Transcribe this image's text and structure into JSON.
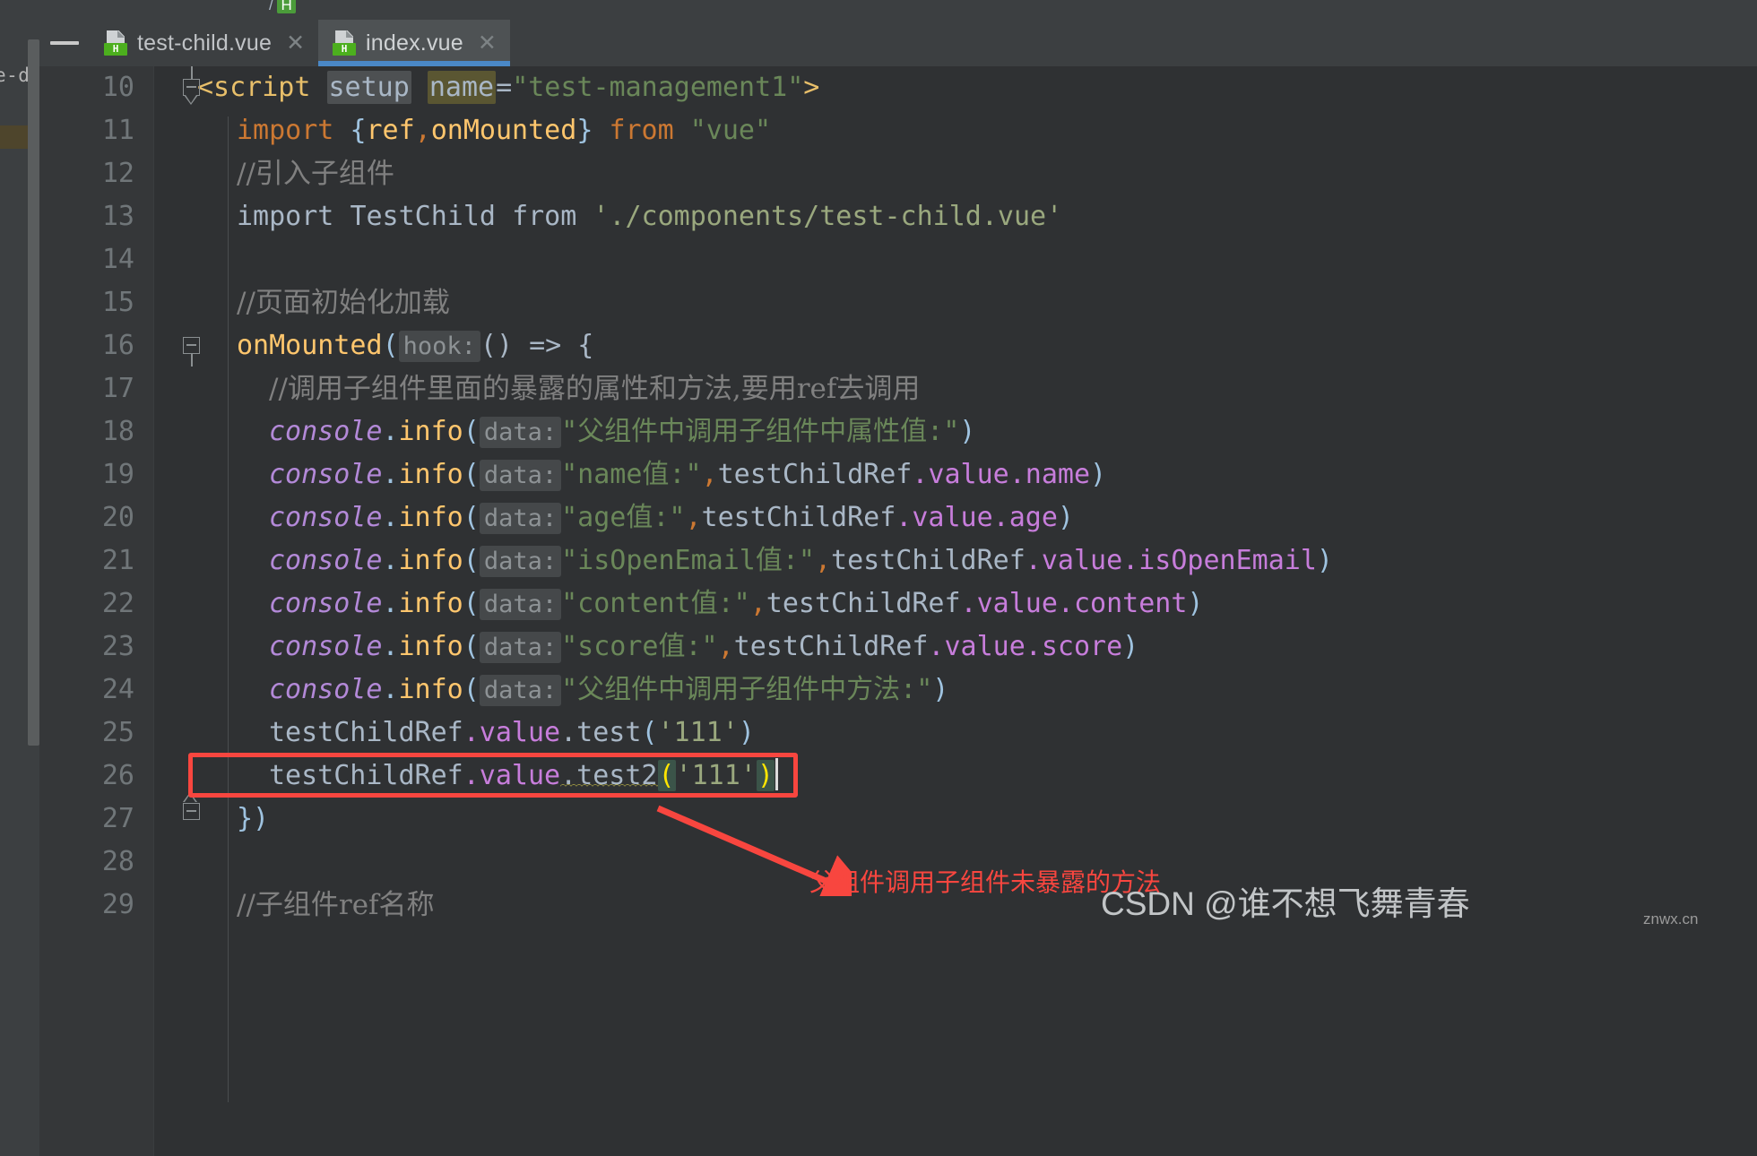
{
  "window": {
    "breadcrumb_prefix": "/",
    "breadcrumb_badge": "H"
  },
  "titlebar": {
    "minimize_label": "—"
  },
  "tabs": [
    {
      "label": "test-child.vue",
      "icon": "vue-file-icon",
      "icon_letter": "H",
      "close": "✕",
      "active": false
    },
    {
      "label": "index.vue",
      "icon": "vue-file-icon",
      "icon_letter": "H",
      "close": "✕",
      "active": true
    }
  ],
  "editor": {
    "file": "index.vue",
    "first_line": 10,
    "caret_line": 26,
    "lines": [
      {
        "num": "10",
        "indent": 0
      },
      {
        "num": "11",
        "indent": 1
      },
      {
        "num": "12",
        "indent": 1
      },
      {
        "num": "13",
        "indent": 1
      },
      {
        "num": "14",
        "indent": 0
      },
      {
        "num": "15",
        "indent": 1
      },
      {
        "num": "16",
        "indent": 1
      },
      {
        "num": "17",
        "indent": 2
      },
      {
        "num": "18",
        "indent": 2
      },
      {
        "num": "19",
        "indent": 2
      },
      {
        "num": "20",
        "indent": 2
      },
      {
        "num": "21",
        "indent": 2
      },
      {
        "num": "22",
        "indent": 2
      },
      {
        "num": "23",
        "indent": 2
      },
      {
        "num": "24",
        "indent": 2
      },
      {
        "num": "25",
        "indent": 2
      },
      {
        "num": "26",
        "indent": 2
      },
      {
        "num": "27",
        "indent": 1
      },
      {
        "num": "28",
        "indent": 0
      },
      {
        "num": "29",
        "indent": 1
      }
    ],
    "code": {
      "l10_tag": "<script",
      "l10_setup": "setup",
      "l10_name": "name",
      "l10_eq": "=",
      "l10_value": "\"test-management1\"",
      "l10_gt": ">",
      "l11_import": "import",
      "l11_brace_open": "{",
      "l11_ref": "ref",
      "l11_comma": ",",
      "l11_onmounted": "onMounted",
      "l11_brace_close": "}",
      "l11_from": "from",
      "l11_module": "\"vue\"",
      "l12_comment": "//引入子组件",
      "l13_import": "import",
      "l13_ident": "TestChild",
      "l13_from": "from",
      "l13_path": "'./components/test-child.vue'",
      "l15_comment": "//页面初始化加载",
      "l16_fn": "onMounted",
      "l16_paren": "(",
      "l16_hint": "hook:",
      "l16_args": "()",
      "l16_arrow": "=>",
      "l16_brace": "{",
      "l17_comment": "//调用子组件里面的暴露的属性和方法,要用ref去调用",
      "console": "console",
      "dot": ".",
      "info": "info",
      "paren_open": "(",
      "paren_close": ")",
      "hint_data": "data:",
      "comma": ",",
      "ref_obj": "testChildRef",
      "dot_value": ".value",
      "l18_str": "\"父组件中调用子组件中属性值:\"",
      "l19_str": "\"name值:\"",
      "l19_prop": ".name",
      "l20_str": "\"age值:\"",
      "l20_prop": ".age",
      "l21_str": "\"isOpenEmail值:\"",
      "l21_prop": ".isOpenEmail",
      "l22_str": "\"content值:\"",
      "l22_prop": ".content",
      "l23_str": "\"score值:\"",
      "l23_prop": ".score",
      "l24_str": "\"父组件中调用子组件中方法:\"",
      "l25_call": ".test",
      "l25_arg": "'111'",
      "l26_call": ".test2",
      "l26_arg": "'111'",
      "l27_close": "})",
      "l29_comment": "//子组件ref名称"
    }
  },
  "annotation": {
    "red_note": "父组件调用子组件未暴露的方法",
    "red_color": "#f8463f",
    "box_target_line": "26"
  },
  "watermark": {
    "text": "CSDN @谁不想飞舞青春",
    "sub": "znwx.cn"
  },
  "project_panel": {
    "clipped_text": "e-de"
  },
  "colors": {
    "editor_bg": "#2f3133",
    "gutter_bg": "#353739",
    "chrome_bg": "#3c3f41",
    "tab_active_bg": "#4e5254",
    "tab_underline": "#4a88c7",
    "string": "#6a8759",
    "keyword": "#cc7832",
    "function": "#ffc66d",
    "console_violet": "#b389d8",
    "property": "#c77ddb",
    "comment": "#808080",
    "plain": "#a9b7c6",
    "tag": "#e8bf6a",
    "bracket_match": "#ffe600"
  }
}
